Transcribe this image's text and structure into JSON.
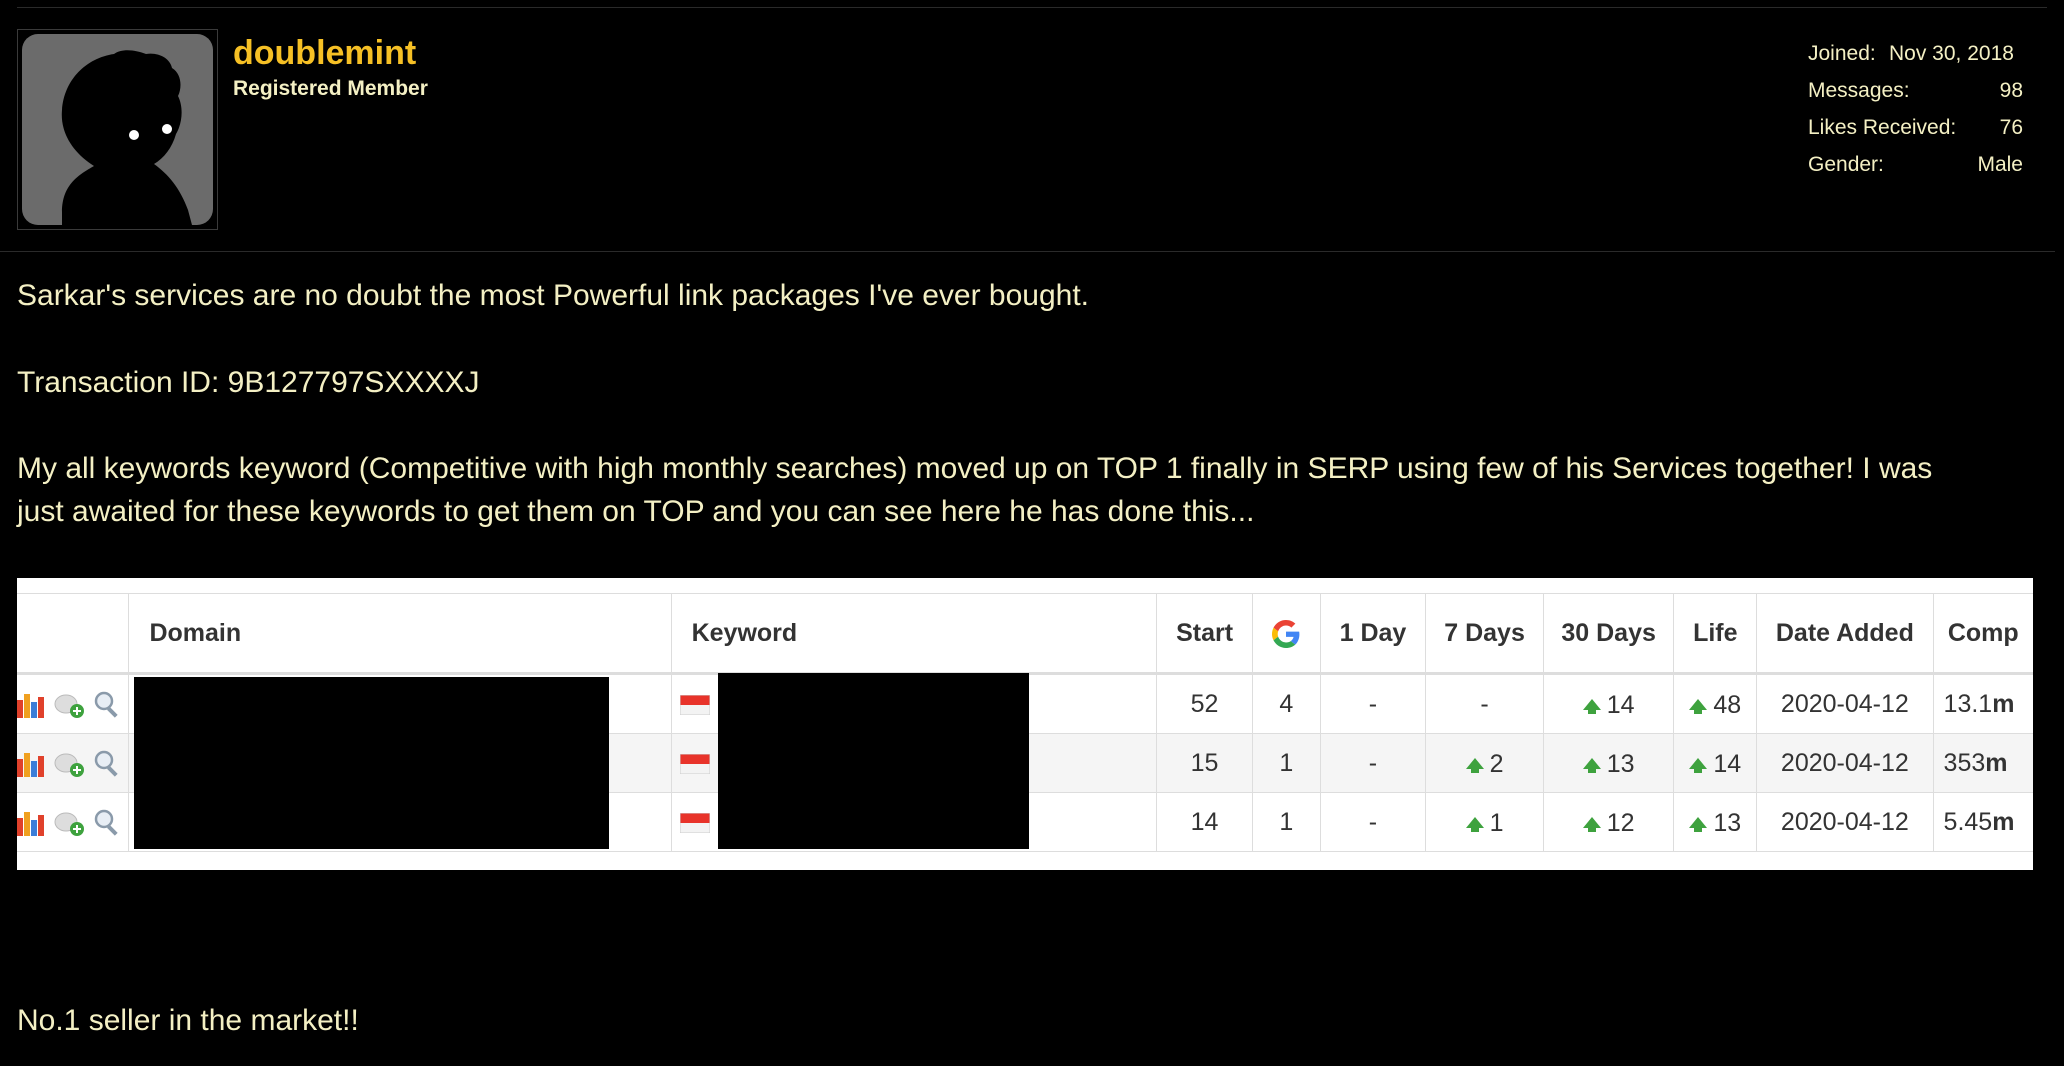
{
  "user": {
    "name": "doublemint",
    "title": "Registered Member",
    "stats": [
      {
        "label": "Joined:",
        "value": "Nov 30, 2018"
      },
      {
        "label": "Messages:",
        "value": "98"
      },
      {
        "label": "Likes Received:",
        "value": "76"
      },
      {
        "label": "Gender:",
        "value": "Male"
      }
    ]
  },
  "post": {
    "line1": "Sarkar's services are no doubt the most Powerful link packages I've ever bought.",
    "line2": "Transaction ID: 9B127797SXXXXJ",
    "line3": "My all keywords keyword (Competitive with high monthly searches) moved up on TOP 1 finally in SERP using few of his Services together! I was",
    "line4": "just awaited for these keywords to get them on TOP and you can see here he has done this...",
    "line5": "No.1 seller in the market!!"
  },
  "table": {
    "headers": [
      "Domain",
      "Keyword",
      "Start",
      "1 Day",
      "7 Days",
      "30 Days",
      "Life",
      "Date Added",
      "Comp"
    ],
    "google_icon": "google-g-icon",
    "row_icons": [
      "bar-chart-icon",
      "add-note-icon",
      "magnifier-icon"
    ],
    "rows": [
      {
        "start": "52",
        "google": "4",
        "day1": "-",
        "days7": "-",
        "days7_up": false,
        "days30": "14",
        "days30_up": true,
        "life": "48",
        "life_up": true,
        "date": "2020-04-12",
        "comp_num": "13.1",
        "comp_unit": "m"
      },
      {
        "start": "15",
        "google": "1",
        "day1": "-",
        "days7": "2",
        "days7_up": true,
        "days30": "13",
        "days30_up": true,
        "life": "14",
        "life_up": true,
        "date": "2020-04-12",
        "comp_num": "353",
        "comp_unit": "m"
      },
      {
        "start": "14",
        "google": "1",
        "day1": "-",
        "days7": "1",
        "days7_up": true,
        "days30": "12",
        "days30_up": true,
        "life": "13",
        "life_up": true,
        "date": "2020-04-12",
        "comp_num": "5.45",
        "comp_unit": "m"
      }
    ]
  },
  "colors": {
    "username": "#f6c025",
    "text": "#f4f0c4",
    "up_arrow": "#3ea23e"
  }
}
